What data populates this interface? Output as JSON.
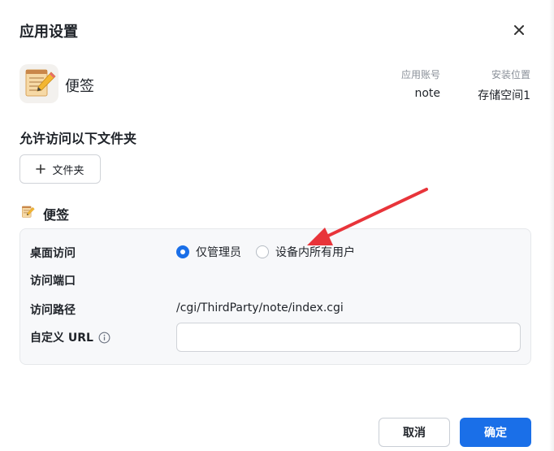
{
  "dialog": {
    "title": "应用设置"
  },
  "app": {
    "name": "便签",
    "account_label": "应用账号",
    "account_value": "note",
    "location_label": "安装位置",
    "location_value": "存储空间1"
  },
  "folders": {
    "section_title": "允许访问以下文件夹",
    "add_button_label": "文件夹"
  },
  "sub_section": {
    "title": "便签",
    "desktop_access_label": "桌面访问",
    "radio_options": [
      {
        "label": "仅管理员",
        "selected": true
      },
      {
        "label": "设备内所有用户",
        "selected": false
      }
    ],
    "access_port_label": "访问端口",
    "access_path_label": "访问路径",
    "access_path_value": "/cgi/ThirdParty/note/index.cgi",
    "custom_url_label": "自定义 URL",
    "custom_url_value": ""
  },
  "footer": {
    "cancel_label": "取消",
    "ok_label": "确定"
  },
  "colors": {
    "primary": "#1a6fe8",
    "annotation_arrow": "#e8343a"
  },
  "icons": {
    "close": "close-icon",
    "app": "notepad-pencil-icon",
    "add": "plus-icon",
    "info": "info-circle-icon"
  }
}
